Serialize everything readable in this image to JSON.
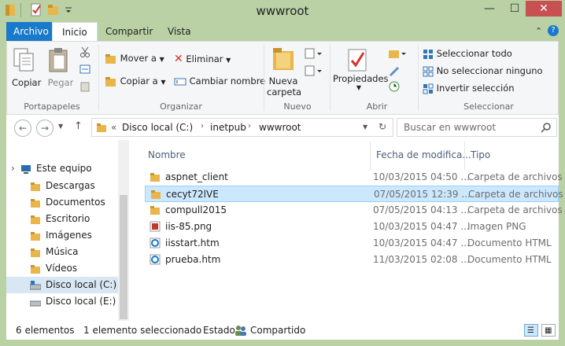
{
  "window": {
    "title": "wwwroot"
  },
  "title_controls": {
    "minimize": "—",
    "maximize": "☐",
    "close": "✕"
  },
  "ribbon_tabs": [
    "Archivo",
    "Inicio",
    "Compartir",
    "Vista"
  ],
  "ribbon": {
    "copiar": "Copiar",
    "pegar": "Pegar",
    "portapapeles": "Portapapeles",
    "mover_a": "Mover a",
    "copiar_a": "Copiar a",
    "eliminar": "Eliminar",
    "cambiar_nombre": "Cambiar nombre",
    "organizar": "Organizar",
    "nueva_carpeta_1": "Nueva",
    "nueva_carpeta_2": "carpeta",
    "nuevo": "Nuevo",
    "propiedades": "Propiedades",
    "abrir": "Abrir",
    "seleccionar_todo": "Seleccionar todo",
    "no_seleccionar_ninguno": "No seleccionar ninguno",
    "invertir_seleccion": "Invertir selección",
    "seleccionar": "Seleccionar"
  },
  "address": {
    "prefix": "«",
    "crumbs": [
      "Disco local (C:)",
      "inetpub",
      "wwwroot"
    ],
    "search_placeholder": "Buscar en wwwroot"
  },
  "nav_tree": [
    {
      "label": "Este equipo",
      "icon": "computer-icon"
    },
    {
      "label": "Descargas",
      "icon": "downloads-folder-icon"
    },
    {
      "label": "Documentos",
      "icon": "documents-folder-icon"
    },
    {
      "label": "Escritorio",
      "icon": "desktop-folder-icon"
    },
    {
      "label": "Imágenes",
      "icon": "pictures-folder-icon"
    },
    {
      "label": "Música",
      "icon": "music-folder-icon"
    },
    {
      "label": "Vídeos",
      "icon": "videos-folder-icon"
    },
    {
      "label": "Disco local (C:)",
      "icon": "system-drive-icon"
    },
    {
      "label": "Disco local (E:)",
      "icon": "drive-icon"
    }
  ],
  "columns": {
    "name": "Nombre",
    "date": "Fecha de modifica...",
    "type": "Tipo"
  },
  "files": [
    {
      "name": "aspnet_client",
      "date": "10/03/2015 04:50 ...",
      "type": "Carpeta de archivos",
      "icon": "folder-icon"
    },
    {
      "name": "cecyt72lVE",
      "date": "07/05/2015 12:39 ...",
      "type": "Carpeta de archivos",
      "icon": "folder-icon"
    },
    {
      "name": "compull2015",
      "date": "07/05/2015 04:13 ...",
      "type": "Carpeta de archivos",
      "icon": "folder-icon"
    },
    {
      "name": "iis-85.png",
      "date": "10/03/2015 04:47 ...",
      "type": "Imagen PNG",
      "icon": "png-image-icon"
    },
    {
      "name": "iisstart.htm",
      "date": "10/03/2015 04:47 ...",
      "type": "Documento HTML",
      "icon": "html-document-icon"
    },
    {
      "name": "prueba.htm",
      "date": "11/03/2015 02:08 ...",
      "type": "Documento HTML",
      "icon": "html-document-icon"
    }
  ],
  "status": {
    "count": "6 elementos",
    "selected": "1 elemento seleccionado",
    "state_label": "Estado:",
    "state_value": "Compartido"
  },
  "colors": {
    "window_frame": "#b9d1a4",
    "file_tab": "#1979ca",
    "selection": "#cce8ff",
    "folder": "#e8b64a"
  }
}
